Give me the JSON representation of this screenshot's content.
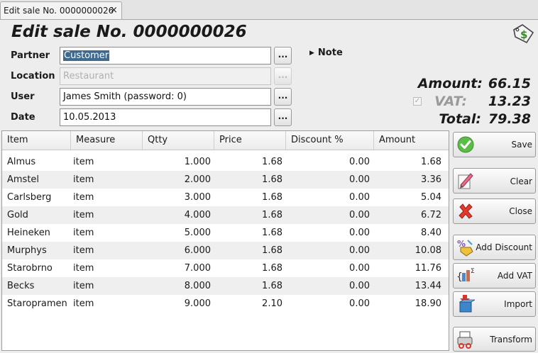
{
  "tab": {
    "label": "Edit sale No. 0000000026",
    "close": "×"
  },
  "title": "Edit sale No. 0000000026",
  "form": {
    "partner": {
      "label": "Partner",
      "value": "Customer"
    },
    "location": {
      "label": "Location",
      "value": "Restaurant"
    },
    "user": {
      "label": "User",
      "value": "James Smith (password: 0)"
    },
    "date": {
      "label": "Date",
      "value": "10.05.2013"
    },
    "ellipsis": "..."
  },
  "note": {
    "label": "Note"
  },
  "totals": {
    "amount_label": "Amount:",
    "amount": "66.15",
    "vat_label": "VAT:",
    "vat": "13.23",
    "vat_checked": true,
    "total_label": "Total:",
    "total": "79.38"
  },
  "table": {
    "columns": [
      "Item",
      "Measure",
      "Qtty",
      "Price",
      "Discount %",
      "Amount"
    ],
    "rows": [
      [
        "Almus",
        "item",
        "1.000",
        "1.68",
        "0.00",
        "1.68"
      ],
      [
        "Amstel",
        "item",
        "2.000",
        "1.68",
        "0.00",
        "3.36"
      ],
      [
        "Carlsberg",
        "item",
        "3.000",
        "1.68",
        "0.00",
        "5.04"
      ],
      [
        "Gold",
        "item",
        "4.000",
        "1.68",
        "0.00",
        "6.72"
      ],
      [
        "Heineken",
        "item",
        "5.000",
        "1.68",
        "0.00",
        "8.40"
      ],
      [
        "Murphys",
        "item",
        "6.000",
        "1.68",
        "0.00",
        "10.08"
      ],
      [
        "Starobrno",
        "item",
        "7.000",
        "1.68",
        "0.00",
        "11.76"
      ],
      [
        "Becks",
        "item",
        "8.000",
        "1.68",
        "0.00",
        "13.44"
      ],
      [
        "Staropramen",
        "item",
        "9.000",
        "2.10",
        "0.00",
        "18.90"
      ]
    ]
  },
  "actions": {
    "save": "Save",
    "clear": "Clear",
    "close": "Close",
    "add_discount": "Add Discount",
    "add_vat": "Add VAT",
    "import": "Import",
    "transform": "Transform"
  },
  "colors": {
    "selection": "#3f6a8f",
    "save_icon": "#4caf3c",
    "close_icon": "#e0382c",
    "import_icon": "#3d7fc4"
  }
}
